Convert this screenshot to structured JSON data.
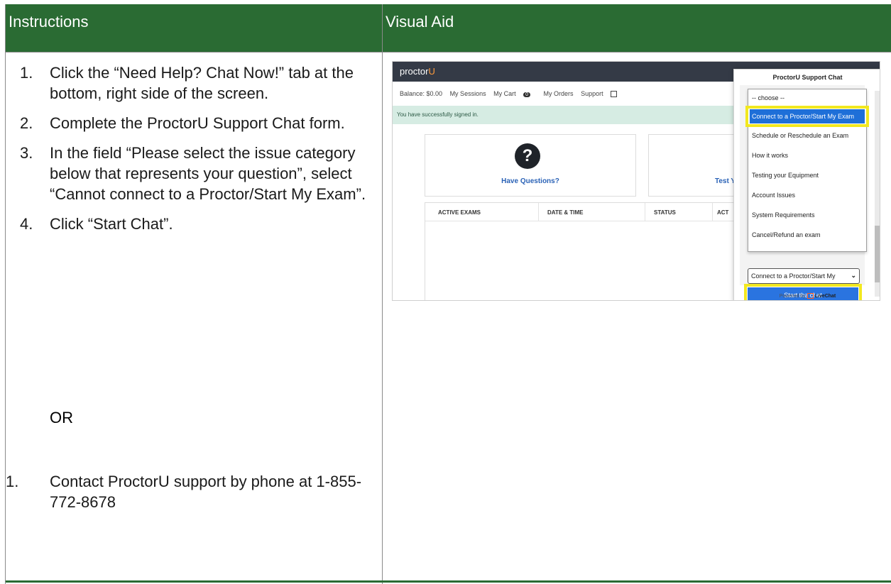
{
  "headers": {
    "instructions": "Instructions",
    "visual_aid": "Visual Aid"
  },
  "steps": [
    {
      "num": "1.",
      "text": "Click the “Need Help? Chat Now!” tab at the bottom, right side of the screen."
    },
    {
      "num": "2.",
      "text": "Complete the ProctorU Support Chat form."
    },
    {
      "num": "3.",
      "text": "In the field “Please select the issue category below that represents your question”, select “Cannot connect to a Proctor/Start My Exam”."
    },
    {
      "num": "4.",
      "text": "Click “Start Chat”."
    }
  ],
  "or_label": "OR",
  "alternative": {
    "num": "1.",
    "text": "Contact ProctorU support by phone at 1-855-772-8678"
  },
  "screenshot": {
    "logo": "proctor",
    "logo_accent": "U",
    "nav": {
      "balance": "Balance: $0.00",
      "sessions": "My Sessions",
      "cart": "My Cart",
      "cart_count": "0",
      "orders": "My Orders",
      "support": "Support"
    },
    "success_message": "You have successfully signed in.",
    "card1_label": "Have Questions?",
    "card2_label": "Test Y",
    "table_headers": [
      "ACTIVE EXAMS",
      "DATE & TIME",
      "STATUS",
      "ACT"
    ],
    "chat": {
      "title": "ProctorU Support Chat",
      "options": [
        "-- choose --",
        "Connect to a Proctor/Start My Exam",
        "Schedule or Reschedule an Exam",
        "How it works",
        "Testing your Equipment",
        "Account Issues",
        "System Requirements",
        "Cancel/Refund an exam"
      ],
      "selected_value": "Connect to a Proctor/Start My",
      "start_button": "Start the chat",
      "powered_prefix": "Powered by",
      "powered_brand": "LiveChat"
    }
  },
  "colors": {
    "header_green": "#2a6b33",
    "highlight_yellow": "#f2e81f",
    "selected_blue": "#1e6fd8"
  }
}
